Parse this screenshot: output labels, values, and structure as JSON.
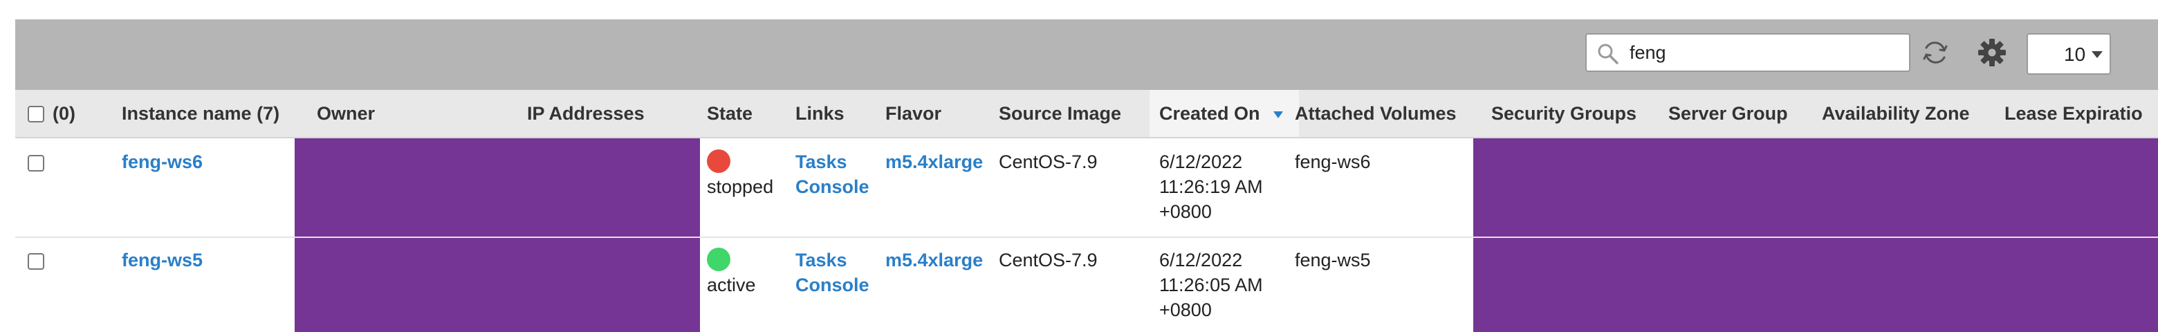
{
  "toolbar": {
    "search_value": "feng",
    "page_size": "10",
    "icons": [
      "search-icon",
      "refresh-icon",
      "gear-icon",
      "chevron-down-icon"
    ]
  },
  "table": {
    "columns": {
      "select": "(0)",
      "instance_name": "Instance name (7)",
      "owner": "Owner",
      "ip_addresses": "IP Addresses",
      "state": "State",
      "links": "Links",
      "flavor": "Flavor",
      "source_image": "Source Image",
      "created_on": "Created On",
      "attached_volumes": "Attached Volumes",
      "security_groups": "Security Groups",
      "server_group": "Server Group",
      "availability_zone": "Availability Zone",
      "lease_expiration": "Lease Expiratio"
    },
    "sort": {
      "column": "created_on",
      "direction": "descending"
    },
    "rows": [
      {
        "name": "feng-ws6",
        "state": "stopped",
        "state_color": "#e8493c",
        "links": [
          "Tasks",
          "Console"
        ],
        "flavor": "m5.4xlarge",
        "source_image": "CentOS-7.9",
        "created_on": [
          "6/12/2022",
          "11:26:19 AM",
          "+0800"
        ],
        "attached_volumes": "feng-ws6"
      },
      {
        "name": "feng-ws5",
        "state": "active",
        "state_color": "#3fd66a",
        "links": [
          "Tasks",
          "Console"
        ],
        "flavor": "m5.4xlarge",
        "source_image": "CentOS-7.9",
        "created_on": [
          "6/12/2022",
          "11:26:05 AM",
          "+0800"
        ],
        "attached_volumes": "feng-ws5"
      }
    ]
  },
  "colors": {
    "toolbar_bg": "#b5b5b5",
    "header_bg": "#e8e8e8",
    "link": "#2a7fc9",
    "redaction": "#743594"
  }
}
